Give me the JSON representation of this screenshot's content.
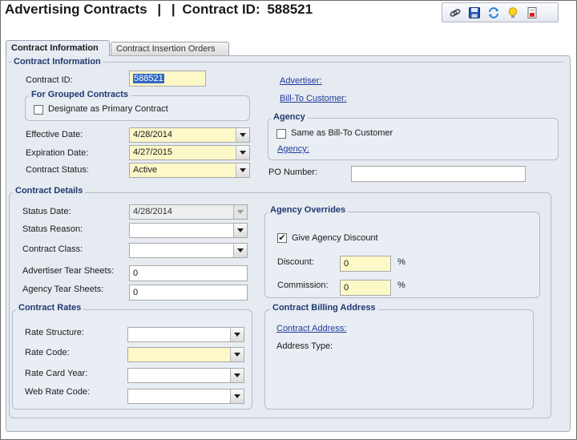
{
  "header": {
    "title": "Advertising Contracts",
    "separator": "|",
    "contract_id_label": "Contract ID:",
    "contract_id_value": "588521"
  },
  "toolbar": {
    "icons": [
      "link-icon",
      "save-icon",
      "refresh-icon",
      "lightbulb-icon",
      "report-icon"
    ]
  },
  "tabs": [
    {
      "label": "Contract Information",
      "active": true
    },
    {
      "label": "Contract Insertion Orders",
      "active": false
    }
  ],
  "contract_information": {
    "legend": "Contract Information",
    "contract_id_label": "Contract ID:",
    "contract_id_value": "588521",
    "grouped": {
      "legend": "For Grouped Contracts",
      "primary_label": "Designate as Primary Contract",
      "primary_checked": false
    },
    "effective_date_label": "Effective Date:",
    "effective_date_value": "4/28/2014",
    "expiration_date_label": "Expiration Date:",
    "expiration_date_value": "4/27/2015",
    "status_label": "Contract Status:",
    "status_value": "Active",
    "advertiser_link": "Advertiser:",
    "bill_to_link": "Bill-To Customer:",
    "agency": {
      "legend": "Agency",
      "same_as_label": "Same as Bill-To Customer",
      "same_as_checked": false,
      "agency_link": "Agency:"
    },
    "po_number_label": "PO Number:",
    "po_number_value": ""
  },
  "contract_details": {
    "legend": "Contract Details",
    "status_date_label": "Status Date:",
    "status_date_value": "4/28/2014",
    "status_reason_label": "Status Reason:",
    "status_reason_value": "",
    "contract_class_label": "Contract Class:",
    "contract_class_value": "",
    "adv_tear_label": "Advertiser Tear Sheets:",
    "adv_tear_value": "0",
    "agency_tear_label": "Agency Tear Sheets:",
    "agency_tear_value": "0",
    "agency_overrides": {
      "legend": "Agency Overrides",
      "give_discount_label": "Give Agency Discount",
      "give_discount_checked": true,
      "discount_label": "Discount:",
      "discount_value": "0",
      "discount_unit": "%",
      "commission_label": "Commission:",
      "commission_value": "0",
      "commission_unit": "%"
    }
  },
  "contract_rates": {
    "legend": "Contract Rates",
    "rate_structure_label": "Rate Structure:",
    "rate_structure_value": "",
    "rate_code_label": "Rate Code:",
    "rate_code_value": "",
    "rate_card_year_label": "Rate Card Year:",
    "rate_card_year_value": "",
    "web_rate_code_label": "Web Rate Code:",
    "web_rate_code_value": ""
  },
  "billing_address": {
    "legend": "Contract Billing Address",
    "contract_address_link": "Contract Address:",
    "address_type_label": "Address Type:"
  },
  "colors": {
    "panel_bg": "#e6eaf1",
    "required_field": "#fdf8c8",
    "legend_text": "#1f3a70",
    "link": "#1f3a9a"
  }
}
